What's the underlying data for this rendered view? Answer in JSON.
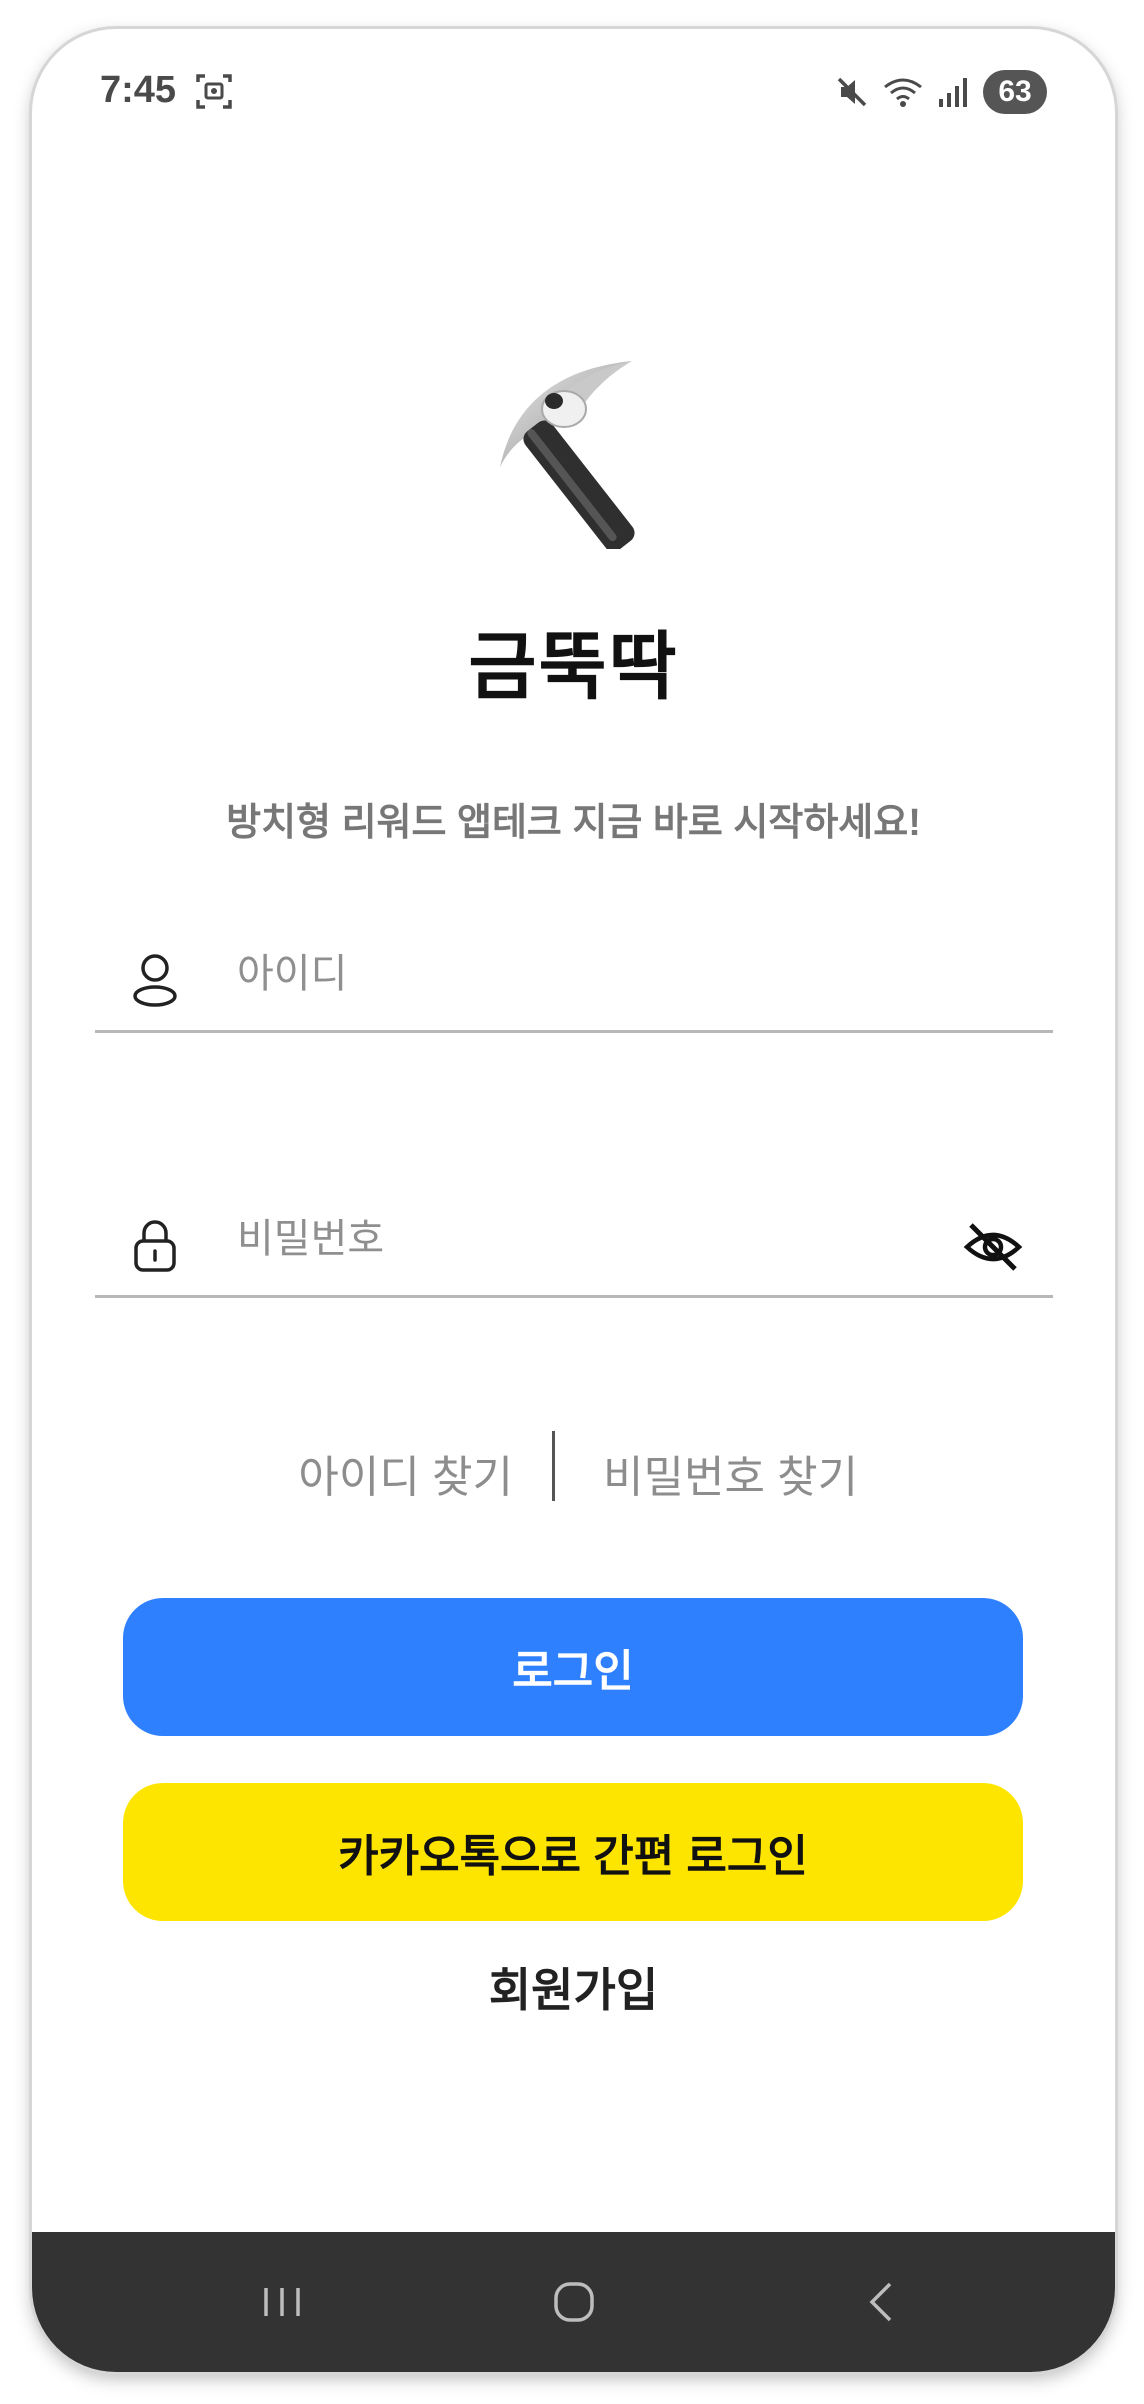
{
  "status_bar": {
    "time": "7:45",
    "battery": "63",
    "icons": [
      "screenshot-icon",
      "mute-icon",
      "wifi-icon",
      "signal-icon",
      "battery-icon"
    ]
  },
  "app": {
    "logo_icon": "pickaxe-icon",
    "title": "금뚝딱",
    "subtitle": "방치형 리워드 앱테크 지금 바로 시작하세요!"
  },
  "login_form": {
    "id_placeholder": "아이디",
    "id_value": "",
    "password_placeholder": "비밀번호",
    "password_value": "",
    "find_id": "아이디 찾기",
    "find_password": "비밀번호 찾기"
  },
  "buttons": {
    "login": "로그인",
    "kakao_login": "카카오톡으로 간편 로그인",
    "signup": "회원가입"
  },
  "colors": {
    "login_button": "#2e80ff",
    "kakao_button": "#fee500",
    "nav_bar": "#333333"
  }
}
